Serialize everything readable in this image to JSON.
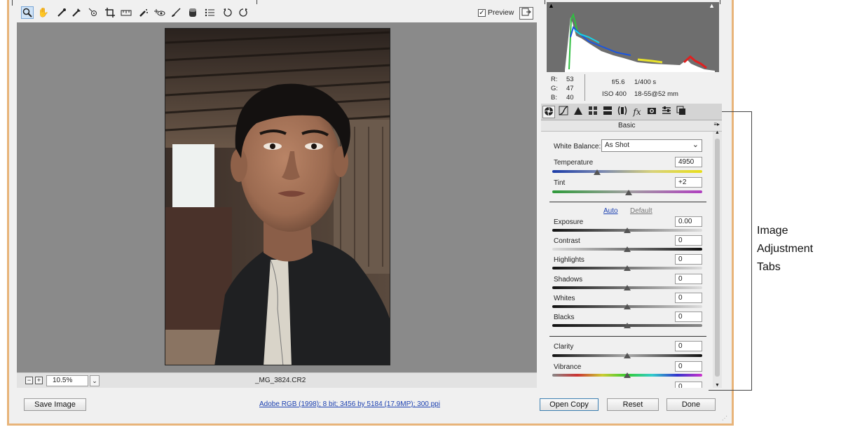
{
  "toolbar": {
    "preview_label": "Preview",
    "preview_checked": "✓"
  },
  "status": {
    "zoom_out": "−",
    "zoom_in": "+",
    "zoom_value": "10.5%",
    "zoom_dropdown": "⌄",
    "filename": "_MG_3824.CR2"
  },
  "histogram": {
    "shadow_clip": "▲",
    "highlight_clip": "▲"
  },
  "info": {
    "r_label": "R:",
    "r_value": "53",
    "g_label": "G:",
    "g_value": "47",
    "b_label": "B:",
    "b_value": "40",
    "aperture": "f/5.6",
    "shutter": "1/400 s",
    "iso": "ISO 400",
    "lens": "18-55@52 mm"
  },
  "panel": {
    "title": "Basic",
    "menu_icon": "≡▸",
    "white_balance_label": "White Balance:",
    "white_balance_value": "As Shot",
    "temperature_label": "Temperature",
    "temperature_value": "4950",
    "tint_label": "Tint",
    "tint_value": "+2",
    "auto_label": "Auto",
    "default_label": "Default",
    "exposure_label": "Exposure",
    "exposure_value": "0.00",
    "contrast_label": "Contrast",
    "contrast_value": "0",
    "highlights_label": "Highlights",
    "highlights_value": "0",
    "shadows_label": "Shadows",
    "shadows_value": "0",
    "whites_label": "Whites",
    "whites_value": "0",
    "blacks_label": "Blacks",
    "blacks_value": "0",
    "clarity_label": "Clarity",
    "clarity_value": "0",
    "vibrance_label": "Vibrance",
    "vibrance_value": "0",
    "saturation_value": "0",
    "scroll_up": "▲",
    "scroll_down": "▼",
    "sliders": {
      "temperature": 0.3,
      "tint": 0.51,
      "exposure": 0.5,
      "contrast": 0.5,
      "highlights": 0.5,
      "shadows": 0.5,
      "whites": 0.5,
      "blacks": 0.5,
      "clarity": 0.5,
      "vibrance": 0.5
    }
  },
  "footer": {
    "save_label": "Save Image",
    "info_link": "Adobe RGB (1998); 8 bit; 3456 by 5184 (17.9MP); 300 ppi",
    "open_copy_label": "Open Copy",
    "reset_label": "Reset",
    "done_label": "Done"
  },
  "annotation": {
    "line1": "Image",
    "line2": "Adjustment",
    "line3": "Tabs"
  },
  "colors": {
    "frame": "#e8b47a",
    "canvas": "#8a8a8a",
    "link": "#1a3fb0",
    "temperature_track": "linear blue-to-yellow",
    "tint_track": "linear green-to-magenta",
    "vibrance_track": "rainbow"
  },
  "icons": {
    "tools": [
      "zoom-tool-icon",
      "hand-tool-icon",
      "white-balance-tool-icon",
      "color-sampler-icon",
      "targeted-adjustment-icon",
      "crop-tool-icon",
      "straighten-tool-icon",
      "spot-removal-icon",
      "red-eye-icon",
      "adjustment-brush-icon",
      "graduated-filter-icon",
      "radial-filter-icon",
      "preferences-icon",
      "rotate-ccw-icon",
      "rotate-cw-icon"
    ],
    "tabs": [
      "basic-tab-icon",
      "tone-curve-tab-icon",
      "detail-tab-icon",
      "hsl-tab-icon",
      "split-toning-tab-icon",
      "lens-corrections-tab-icon",
      "effects-tab-icon",
      "camera-calibration-tab-icon",
      "presets-tab-icon",
      "snapshots-tab-icon"
    ]
  }
}
